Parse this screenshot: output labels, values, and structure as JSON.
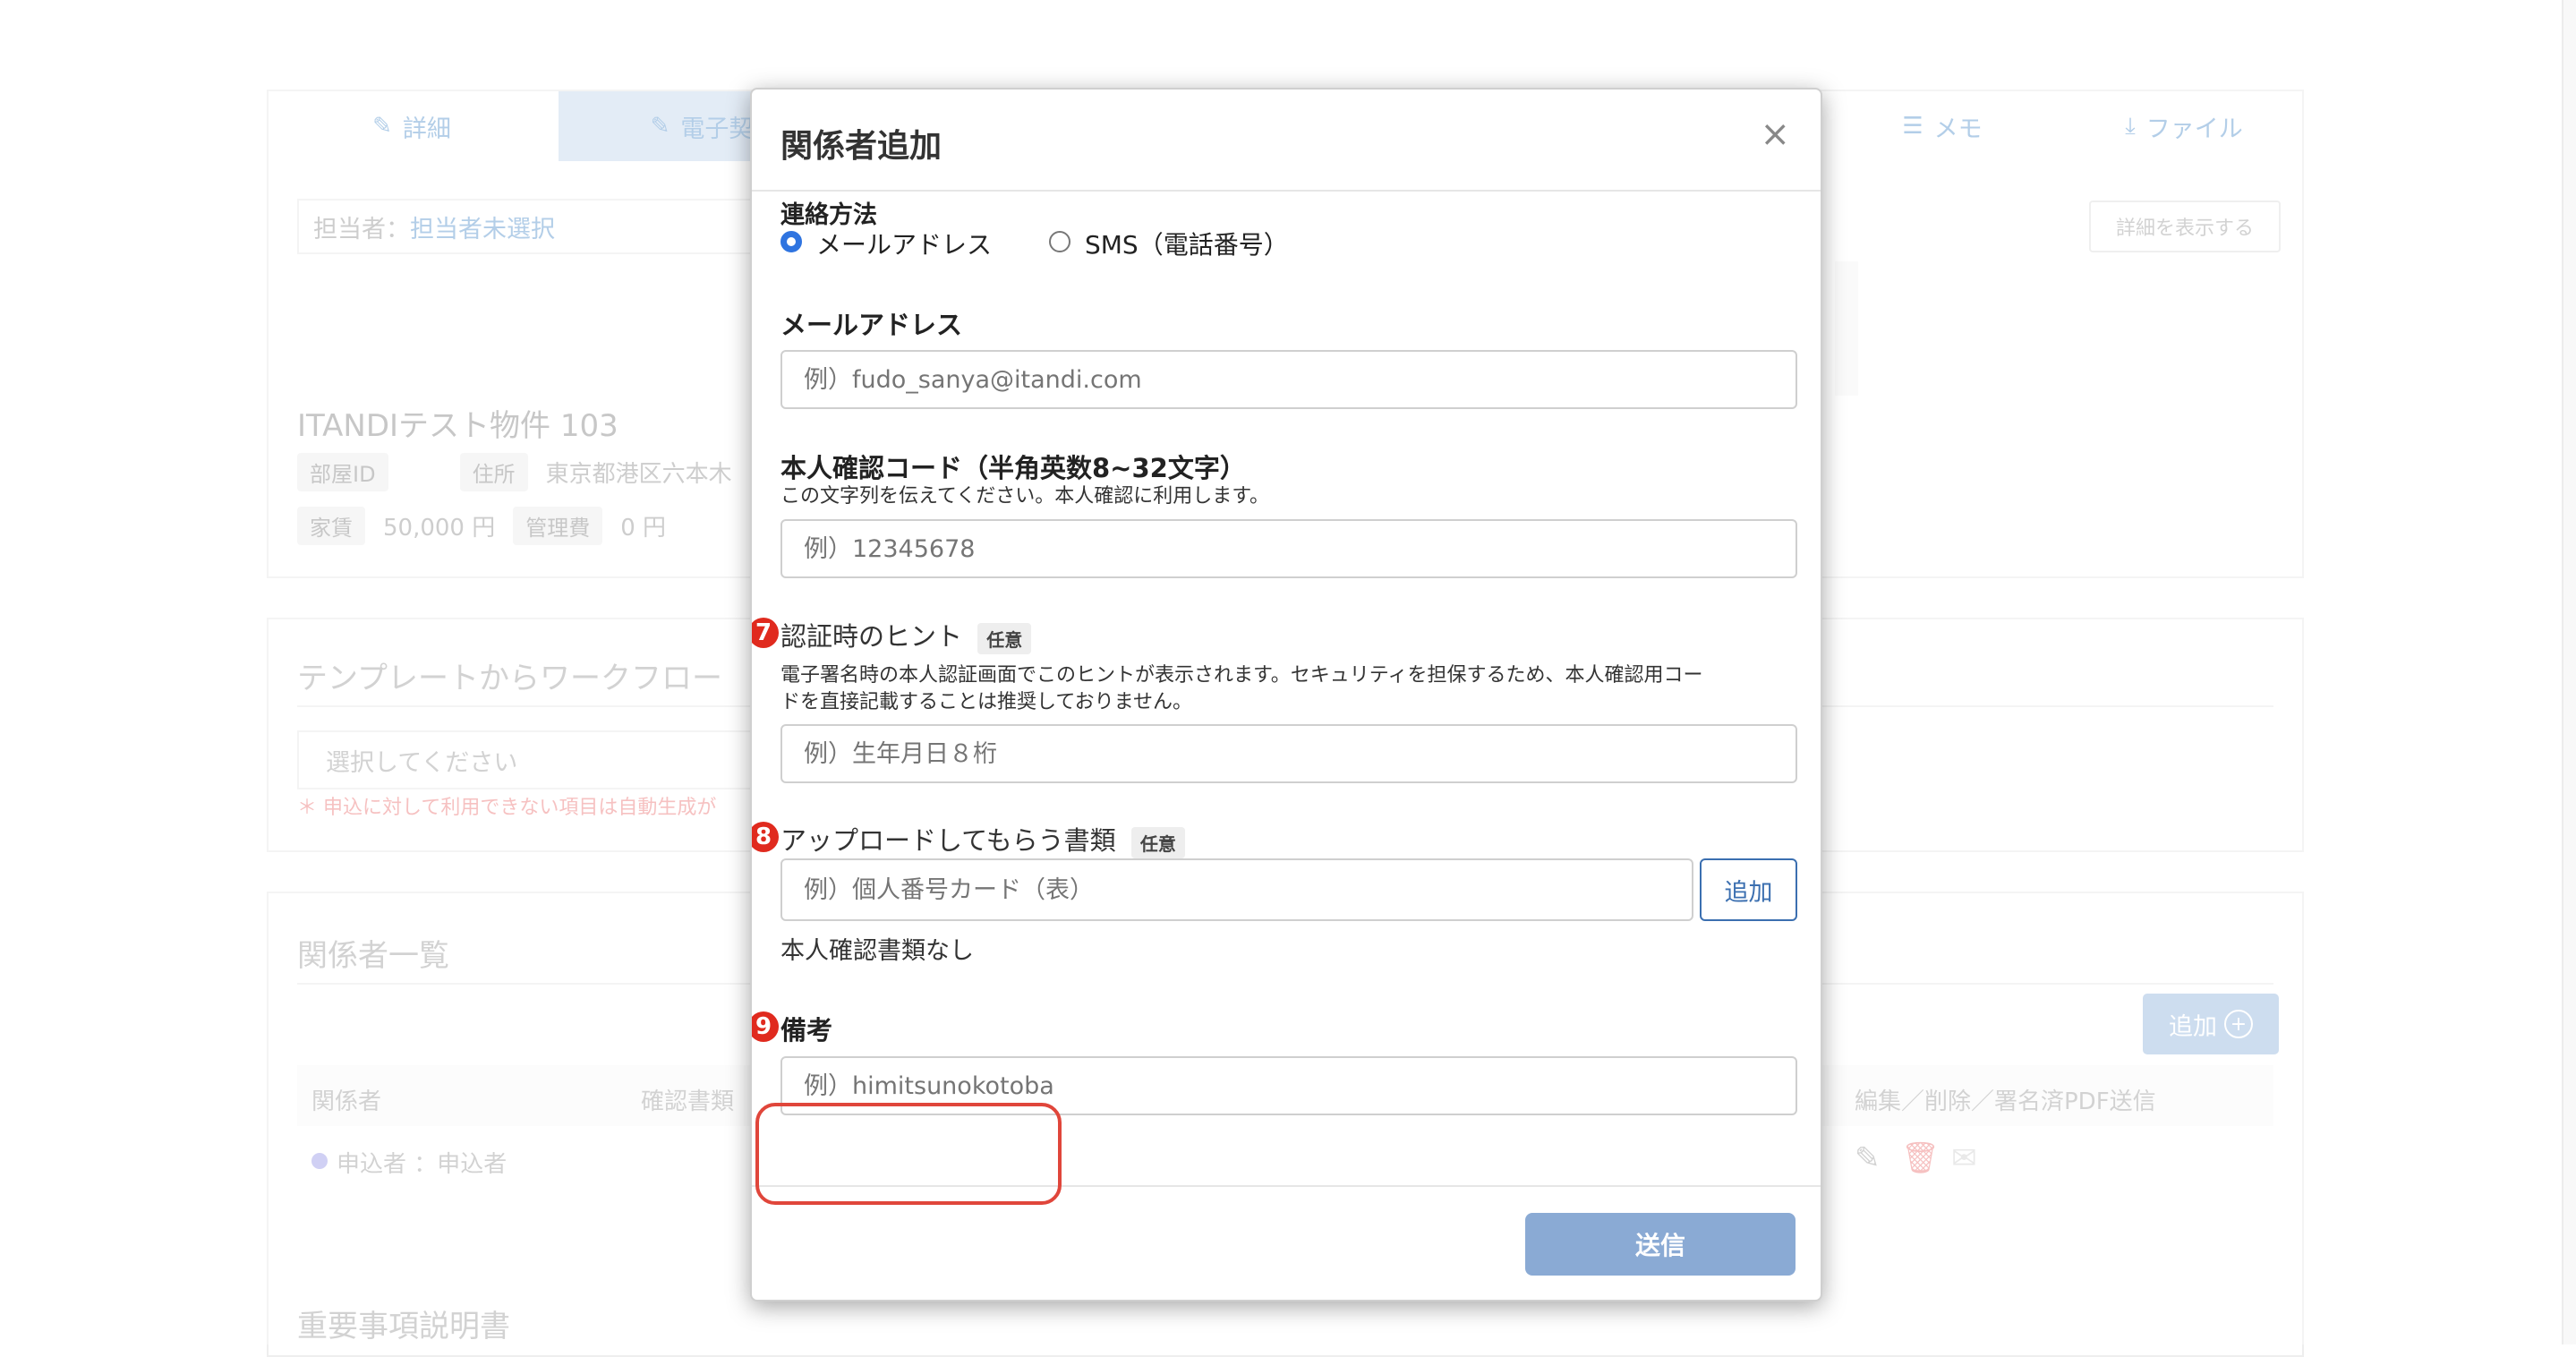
{
  "background": {
    "tabs": [
      {
        "label": "詳細",
        "icon": "edit-icon"
      },
      {
        "label": "電子契",
        "icon": "edit-icon"
      },
      {
        "label": "メモ",
        "icon": "list-icon"
      },
      {
        "label": "ファイル",
        "icon": "download-icon"
      }
    ],
    "assignee_label": "担当者：",
    "assignee_value": "担当者未選択",
    "show_details_button": "詳細を表示する",
    "property_name": "ITANDIテスト物件 103",
    "room_id_label": "部屋ID",
    "address_label": "住所",
    "address_value": "東京都港区六本木",
    "rent_label": "家賃",
    "rent_value": "50,000 円",
    "mgmt_fee_label": "管理費",
    "mgmt_fee_value": "0 円",
    "template_heading": "テンプレートからワークフロー",
    "select_placeholder": "選択してください",
    "auto_note": "＊ 申込に対して利用できない項目は自動生成が",
    "parties_heading": "関係者一覧",
    "add_button": "追加",
    "table_header_party": "関係者",
    "table_header_docs": "確認書類",
    "table_header_actions": "編集／削除／署名済PDF送信",
    "row_party": "申込者 ：申込者",
    "important_heading": "重要事項説明書"
  },
  "modal": {
    "title": "関係者追加",
    "close_symbol": "×",
    "contact_method_label": "連絡方法",
    "contact_options": [
      "メールアドレス",
      "SMS（電話番号）"
    ],
    "contact_selected": "メールアドレス",
    "email_label": "メールアドレス",
    "email_placeholder": "例）fudo_sanya@itandi.com",
    "code_label": "本人確認コード（半角英数8~32文字）",
    "code_help": "この文字列を伝えてください。本人確認に利用します。",
    "code_placeholder": "例）12345678",
    "hint_number": "7",
    "hint_label": "認証時のヒント",
    "optional_badge": "任意",
    "hint_help_line1": "電子署名時の本人認証画面でこのヒントが表示されます。セキュリティを担保するため、本人確認用コー",
    "hint_help_line2": "ドを直接記載することは推奨しておりません。",
    "hint_placeholder": "例）生年月日８桁",
    "upload_number": "8",
    "upload_label": "アップロードしてもらう書類",
    "upload_placeholder": "例）個人番号カード（表）",
    "upload_add_button": "追加",
    "no_docs_text": "本人確認書類なし",
    "notes_number": "9",
    "notes_label": "備考",
    "notes_placeholder": "例）himitsunokotoba",
    "submit_button": "送信"
  },
  "colors": {
    "accent": "#3b6fb0",
    "submit_bg": "#8aaad4",
    "highlight": "#e0463b",
    "step_badge": "#e02a1e"
  }
}
